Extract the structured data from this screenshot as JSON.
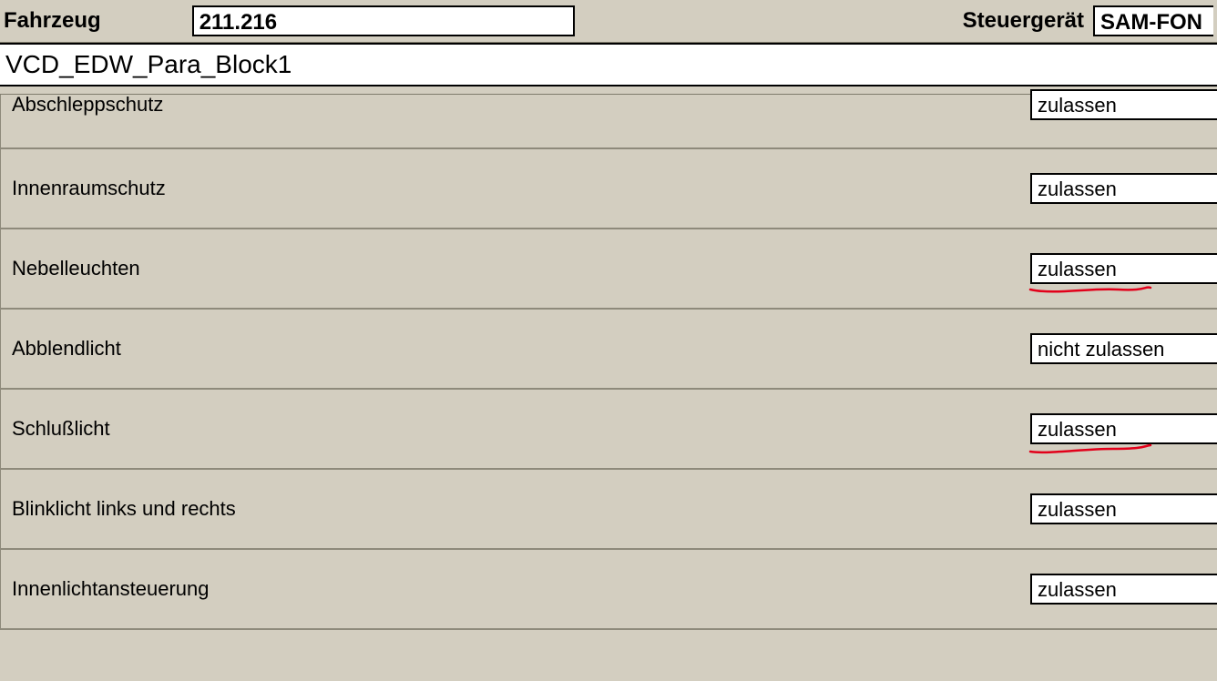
{
  "header": {
    "fahrzeug_label": "Fahrzeug",
    "fahrzeug_value": "211.216",
    "steuergeraet_label": "Steuergerät",
    "steuergeraet_value": "SAM-FON"
  },
  "title": "VCD_EDW_Para_Block1",
  "params": [
    {
      "label": "Abschleppschutz",
      "value": "zulassen",
      "annotated": false
    },
    {
      "label": "Innenraumschutz",
      "value": "zulassen",
      "annotated": false
    },
    {
      "label": "Nebelleuchten",
      "value": "zulassen",
      "annotated": true
    },
    {
      "label": "Abblendlicht",
      "value": "nicht zulassen",
      "annotated": false
    },
    {
      "label": "Schlußlicht",
      "value": "zulassen",
      "annotated": true
    },
    {
      "label": "Blinklicht links und rechts",
      "value": "zulassen",
      "annotated": false
    },
    {
      "label": "Innenlichtansteuerung",
      "value": "zulassen",
      "annotated": false
    }
  ]
}
